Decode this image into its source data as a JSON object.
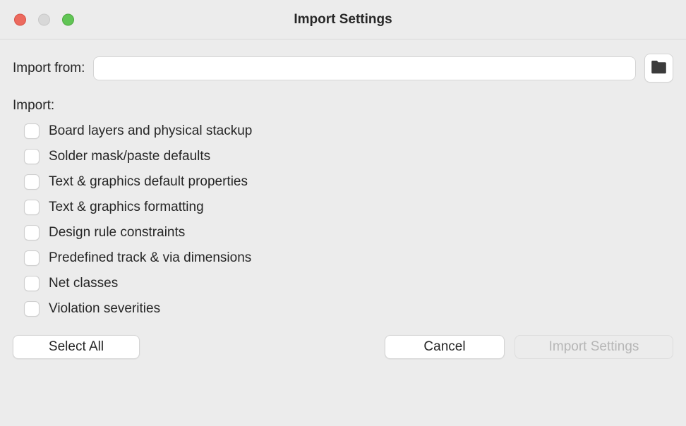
{
  "window": {
    "title": "Import Settings"
  },
  "labels": {
    "import_from": "Import from:",
    "import": "Import:"
  },
  "fields": {
    "path_value": "",
    "path_placeholder": ""
  },
  "options": [
    {
      "label": "Board layers and physical stackup",
      "checked": false
    },
    {
      "label": "Solder mask/paste defaults",
      "checked": false
    },
    {
      "label": "Text & graphics default properties",
      "checked": false
    },
    {
      "label": "Text & graphics formatting",
      "checked": false
    },
    {
      "label": "Design rule constraints",
      "checked": false
    },
    {
      "label": "Predefined track & via dimensions",
      "checked": false
    },
    {
      "label": "Net classes",
      "checked": false
    },
    {
      "label": "Violation severities",
      "checked": false
    }
  ],
  "buttons": {
    "select_all": "Select All",
    "cancel": "Cancel",
    "import_settings": "Import Settings"
  }
}
